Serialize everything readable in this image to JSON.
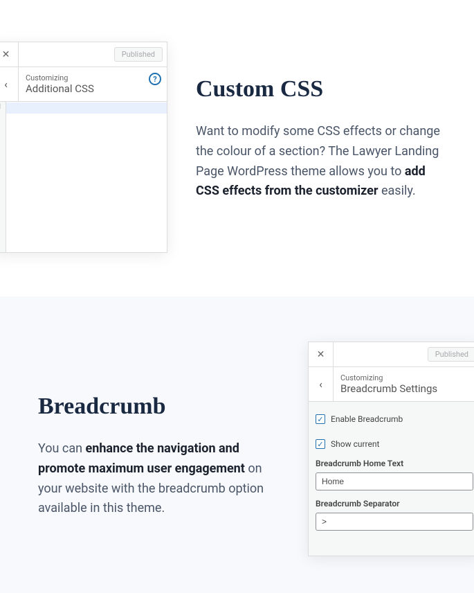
{
  "section1": {
    "heading": "Custom CSS",
    "description_part1": "Want to modify some CSS effects or change the colour of a section? The Lawyer Landing Page WordPress theme allows you to ",
    "description_bold": "add CSS effects from the customizer",
    "description_part2": " easily.",
    "panel": {
      "published": "Published",
      "customizing": "Customizing",
      "section_name": "Additional CSS",
      "line_number": "1",
      "help": "?"
    }
  },
  "section2": {
    "heading": "Breadcrumb",
    "description_part1": "You can ",
    "description_bold": "enhance the navigation and promote maximum user engagement",
    "description_part2": " on your website with the breadcrumb option available in this theme.",
    "panel": {
      "published": "Published",
      "customizing": "Customizing",
      "section_name": "Breadcrumb Settings",
      "enable_breadcrumb": "Enable Breadcrumb",
      "show_current": "Show current",
      "home_text_label": "Breadcrumb Home Text",
      "home_text_value": "Home",
      "separator_label": "Breadcrumb Separator",
      "separator_value": ">"
    }
  },
  "icons": {
    "close": "✕",
    "back": "‹",
    "check": "✓"
  }
}
